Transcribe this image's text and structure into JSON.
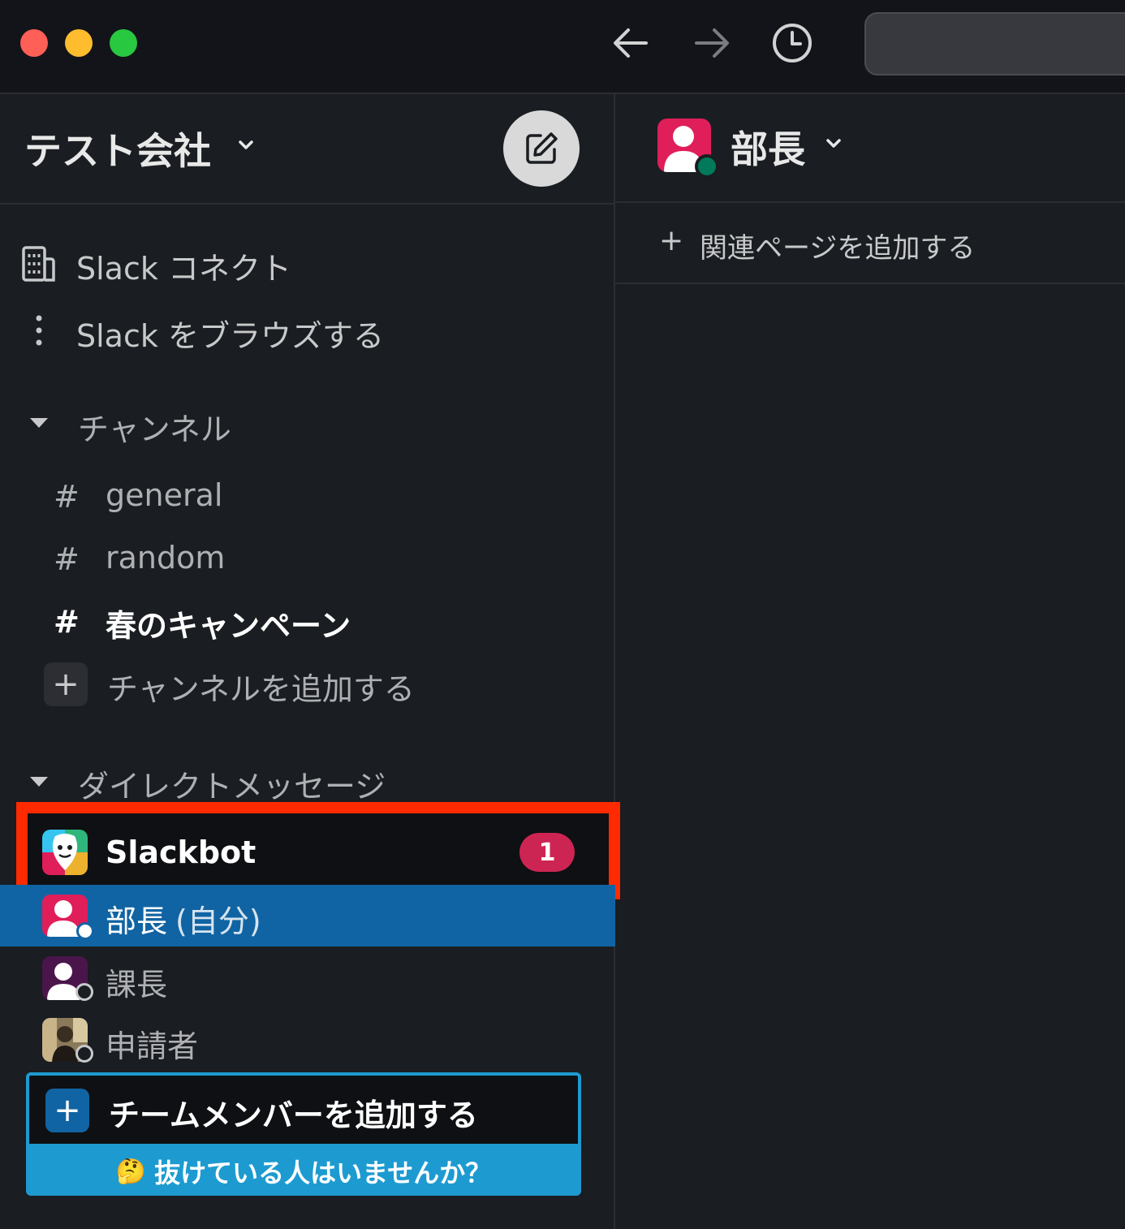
{
  "workspace": {
    "name": "テスト会社"
  },
  "nav": {
    "slack_connect": "Slack コネクト",
    "browse": "Slack をブラウズする"
  },
  "channels": {
    "section_label": "チャンネル",
    "items": [
      {
        "name": "general",
        "prefix": "#"
      },
      {
        "name": "random",
        "prefix": "#"
      },
      {
        "name": "春のキャンペーン",
        "prefix": "#"
      }
    ],
    "add_label": "チャンネルを追加する"
  },
  "dms": {
    "section_label": "ダイレクトメッセージ",
    "items": [
      {
        "name": "Slackbot",
        "badge": "1"
      },
      {
        "name": "部長",
        "suffix": "(自分)"
      },
      {
        "name": "課長"
      },
      {
        "name": "申請者"
      }
    ]
  },
  "team_invite": {
    "label": "チームメンバーを追加する",
    "hint": "抜けている人はいませんか？"
  },
  "main": {
    "title": "部長",
    "add_bookmark": "関連ページを追加する"
  },
  "icons": {
    "plus": "+",
    "emoji": "🤔"
  },
  "colors": {
    "accent_blue": "#1164a3",
    "badge_red": "#cd2553",
    "highlight": "#ff2a00",
    "hint_bg": "#1d9bd1"
  }
}
